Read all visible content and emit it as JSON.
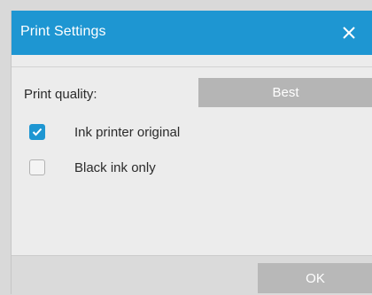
{
  "dialog": {
    "title": "Print Settings",
    "close_icon": "close-icon"
  },
  "print_quality": {
    "label": "Print quality:",
    "selected_value": "Best"
  },
  "options": [
    {
      "label": "Ink printer original",
      "checked": true
    },
    {
      "label": "Black ink only",
      "checked": false
    }
  ],
  "footer": {
    "ok_label": "OK"
  },
  "colors": {
    "accent": "#1e96d2",
    "button_disabled": "#b8b8b8",
    "background": "#ececec"
  }
}
